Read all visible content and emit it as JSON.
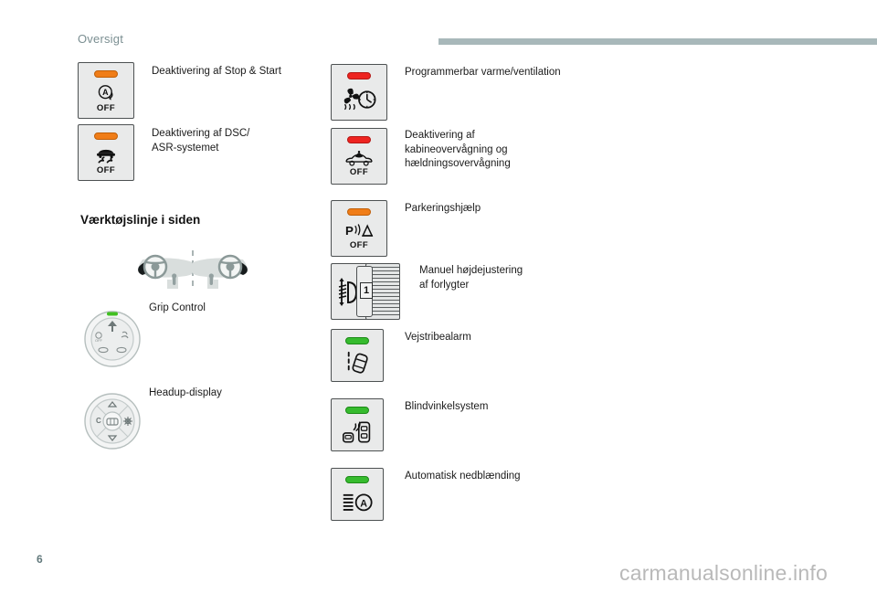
{
  "header": {
    "title": "Oversigt",
    "rule_color": "#a8b8ba"
  },
  "colors": {
    "led_orange": "#f07d18",
    "led_red": "#ee2420",
    "led_green": "#36bb2e",
    "button_face": "#e9eaea",
    "button_border": "#4d5152",
    "header_text": "#7b8f92",
    "body_text": "#1b1b1b",
    "watermark": "#b9b9b9"
  },
  "left_column": {
    "controls": [
      {
        "id": "stop-start",
        "label": "Deaktivering af Stop & Start",
        "led": "orange",
        "icon": "auto-stop-start-off-icon",
        "off_text": "OFF"
      },
      {
        "id": "dsc-asr",
        "label": "Deaktivering af DSC/\nASR-systemet",
        "led": "orange",
        "icon": "traction-control-off-icon",
        "off_text": "OFF"
      }
    ],
    "section_heading": "Værktøjslinje i siden",
    "illustrations": [
      {
        "id": "dashboard-sides",
        "label": "",
        "icon": "dashboard-steering-wheel-icon"
      },
      {
        "id": "grip-control",
        "label": "Grip Control",
        "icon": "grip-control-dial-icon"
      },
      {
        "id": "headup-display",
        "label": "Headup-display",
        "icon": "headup-display-pad-icon"
      }
    ]
  },
  "right_column": {
    "controls": [
      {
        "id": "programmable-heating",
        "label": "Programmerbar varme/ventilation",
        "led": "red",
        "icon": "fan-clock-icon",
        "off_text": ""
      },
      {
        "id": "cabin-tilt-monitoring",
        "label": "Deaktivering af\nkabineovervågning og\nhældningsovervågning",
        "led": "red",
        "icon": "cabin-monitoring-off-icon",
        "off_text": "OFF"
      },
      {
        "id": "parking-assist",
        "label": "Parkeringshjælp",
        "led": "orange",
        "icon": "parking-sensor-off-icon",
        "off_text": "OFF"
      },
      {
        "id": "headlight-adjust",
        "label": "Manuel højdejustering\naf forlygter",
        "led": "none",
        "icon": "headlight-height-knob-icon",
        "knob_value": "1",
        "off_text": ""
      },
      {
        "id": "lane-departure",
        "label": "Vejstribealarm",
        "led": "green",
        "icon": "lane-departure-warning-icon",
        "off_text": ""
      },
      {
        "id": "blind-spot",
        "label": "Blindvinkelsystem",
        "led": "green",
        "icon": "blind-spot-monitor-icon",
        "off_text": ""
      },
      {
        "id": "auto-dipped-beam",
        "label": "Automatisk nedblænding",
        "led": "green",
        "icon": "auto-highbeam-icon",
        "off_text": ""
      }
    ]
  },
  "footer": {
    "page_number": "6",
    "watermark": "carmanualsonline.info"
  }
}
